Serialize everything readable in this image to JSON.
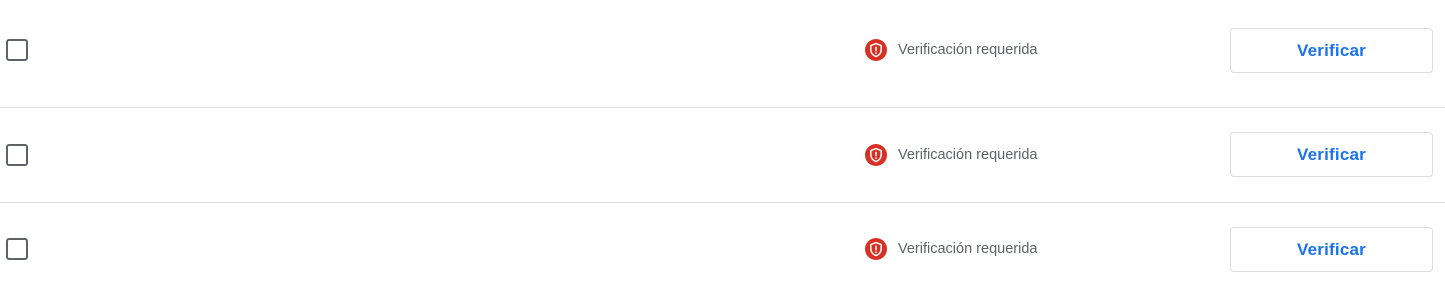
{
  "rows": [
    {
      "checked": false,
      "status_label": "Verificación requerida",
      "status_icon": "shield-alert-icon",
      "action_label": "Verificar"
    },
    {
      "checked": false,
      "status_label": "Verificación requerida",
      "status_icon": "shield-alert-icon",
      "action_label": "Verificar"
    },
    {
      "checked": false,
      "status_label": "Verificación requerida",
      "status_icon": "shield-alert-icon",
      "action_label": "Verificar"
    }
  ],
  "colors": {
    "status_icon": "#d93025",
    "action_text": "#1a73e8",
    "status_text": "#5f6368",
    "divider": "#dadce0"
  }
}
